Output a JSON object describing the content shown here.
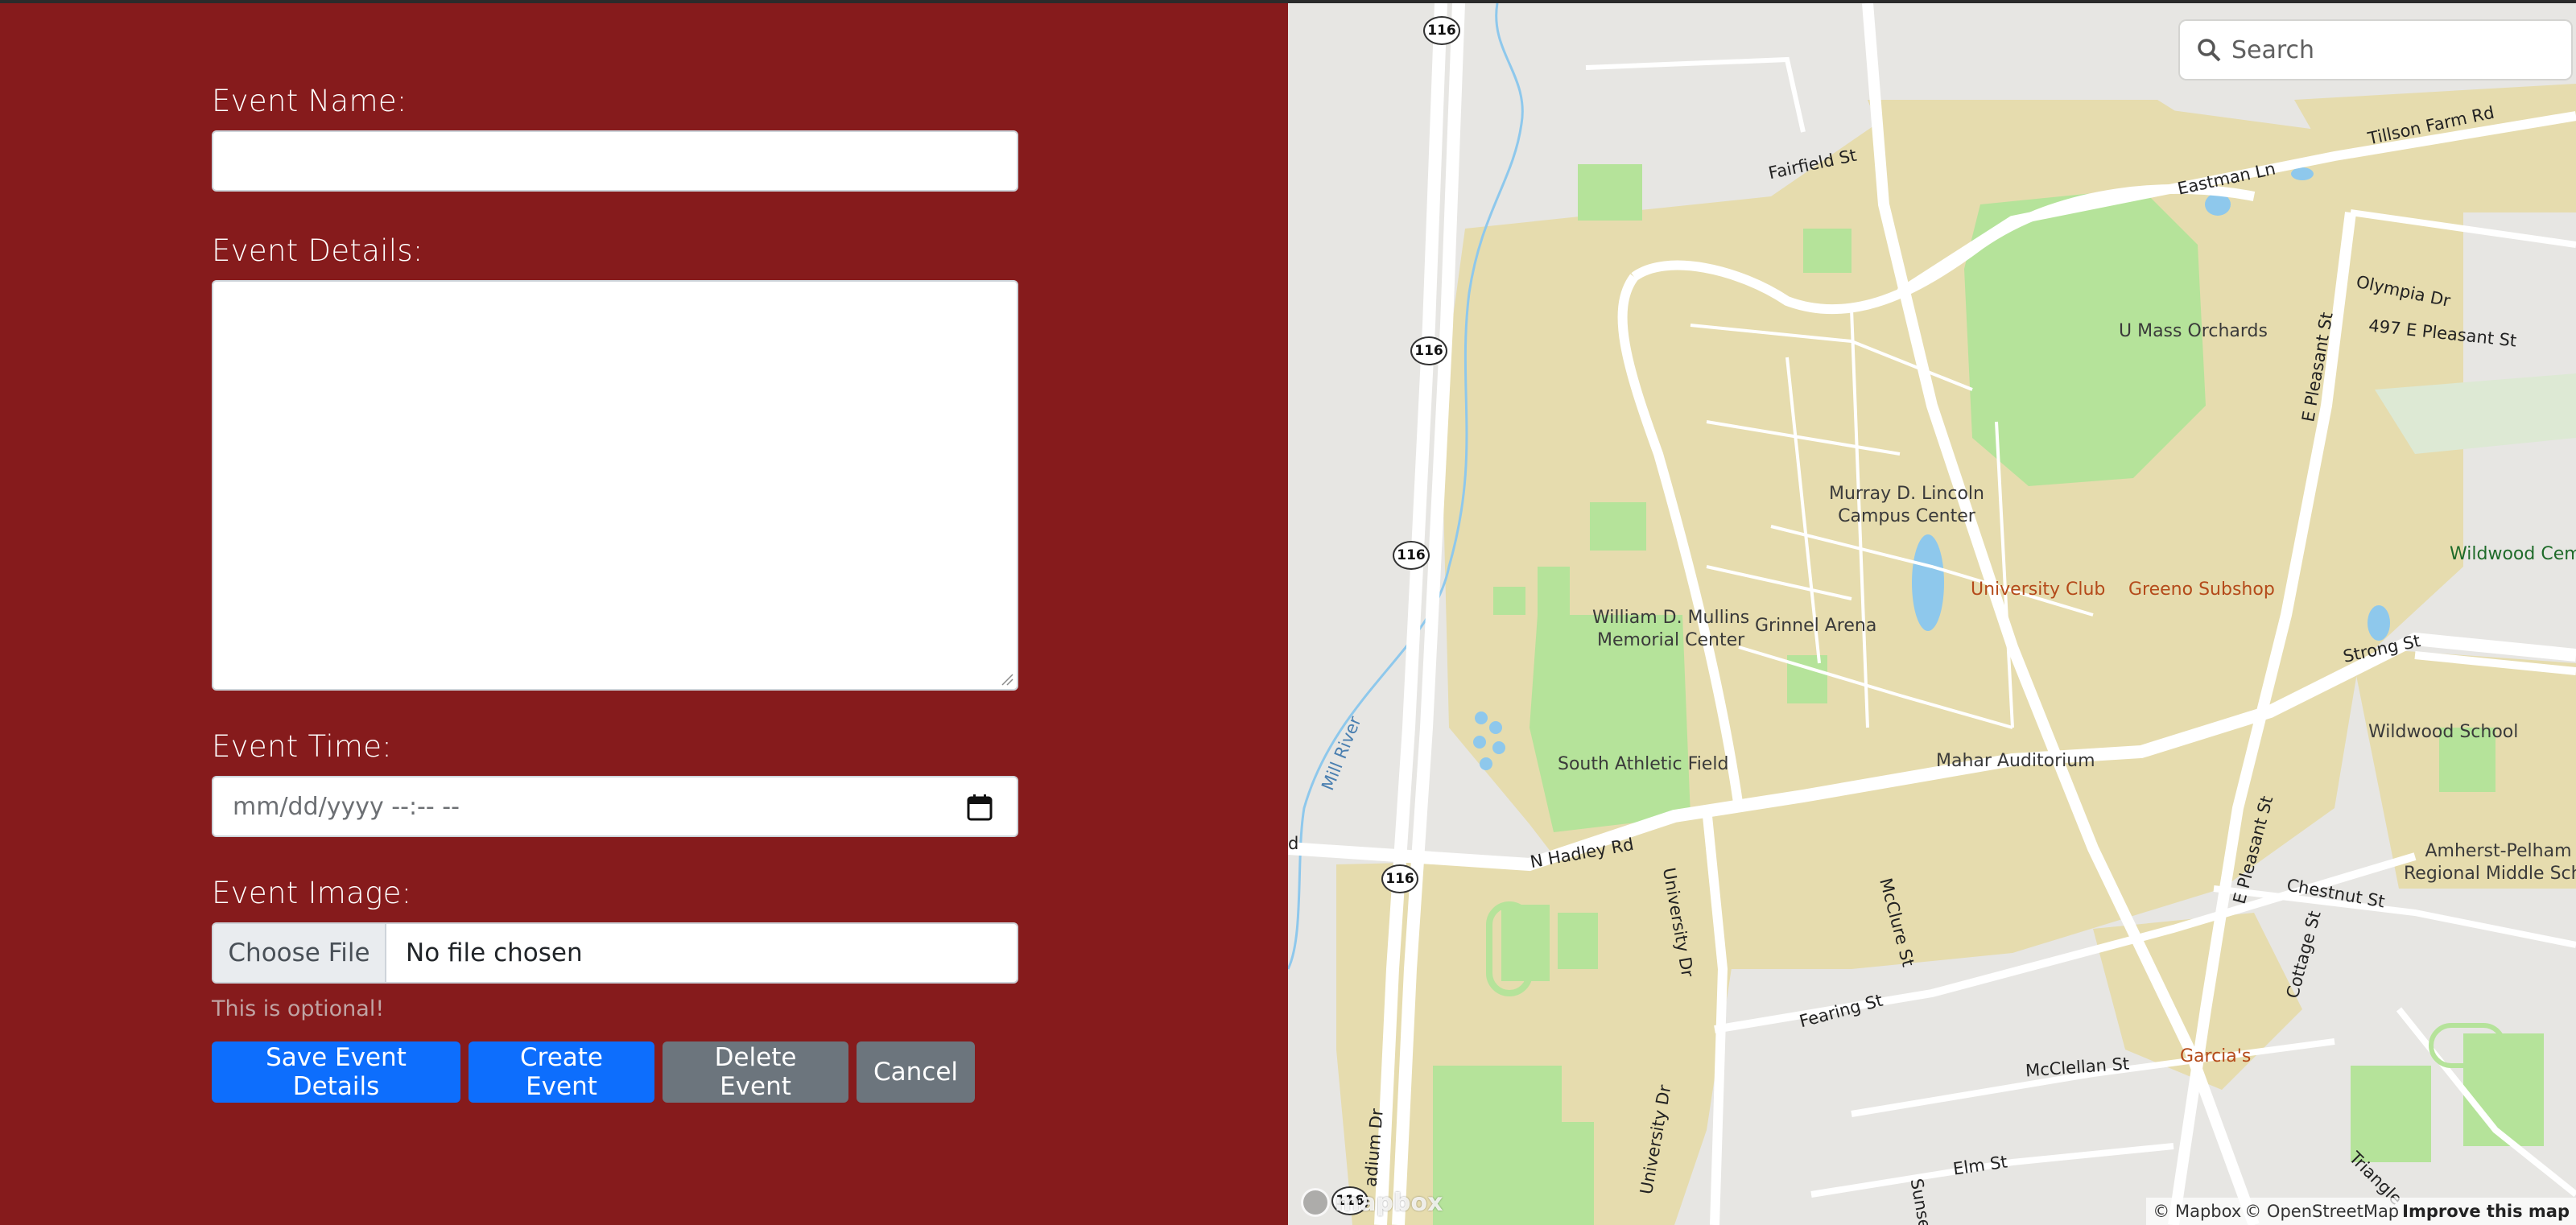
{
  "form": {
    "event_name_label": "Event Name:",
    "event_name_value": "",
    "event_details_label": "Event Details:",
    "event_details_value": "",
    "event_time_label": "Event Time:",
    "event_time_placeholder": "mm/dd/yyyy --:-- --",
    "event_image_label": "Event Image:",
    "choose_file_label": "Choose File",
    "no_file_label": "No file chosen",
    "optional_hint": "This is optional!",
    "buttons": {
      "save": "Save Event Details",
      "create": "Create Event",
      "delete": "Delete Event",
      "cancel": "Cancel"
    }
  },
  "colors": {
    "form_background": "#861b1c",
    "primary_button": "#0d6efd",
    "secondary_button": "#6c757d",
    "campus_fill": "#e6dcae",
    "park_fill": "#b5e39a",
    "water": "#8ec8ec"
  },
  "map": {
    "search_placeholder": "Search",
    "route_shield": "116",
    "pois": {
      "murray": "Murray D. Lincoln\nCampus Center",
      "mullins": "William D. Mullins\nMemorial Center",
      "grinnel": "Grinnel Arena",
      "mahar": "Mahar Auditorium",
      "south_field": "South Athletic Field",
      "orchards": "U Mass Orchards",
      "university_club": "University Club",
      "greeno": "Greeno Subshop",
      "garcias": "Garcia's",
      "wildwood_school": "Wildwood School",
      "wildwood_cem": "Wildwood Cem",
      "amherst_pelham": "Amherst-Pelham\nRegional Middle Scho"
    },
    "streets": {
      "fairfield": "Fairfield St",
      "eastman": "Eastman Ln",
      "tillson": "Tillson Farm Rd",
      "olympia": "Olympia Dr",
      "e_pleasant_497": "497 E Pleasant St",
      "e_pleasant": "E Pleasant St",
      "strong": "Strong St",
      "n_hadley": "N Hadley Rd",
      "university_dr": "University Dr",
      "mcclure": "McClure St",
      "fearing": "Fearing St",
      "mcclellan": "McClellan St",
      "chestnut": "Chestnut St",
      "cottage": "Cottage St",
      "elm": "Elm St",
      "mill_river": "Mill River",
      "stadium": "adium Dr",
      "triangle": "Triangle",
      "sunset": "Sunse",
      "rd": "d"
    },
    "attribution": {
      "mapbox": "© Mapbox",
      "osm": "© OpenStreetMap",
      "improve": "Improve this map"
    },
    "logo": "mapbox"
  }
}
